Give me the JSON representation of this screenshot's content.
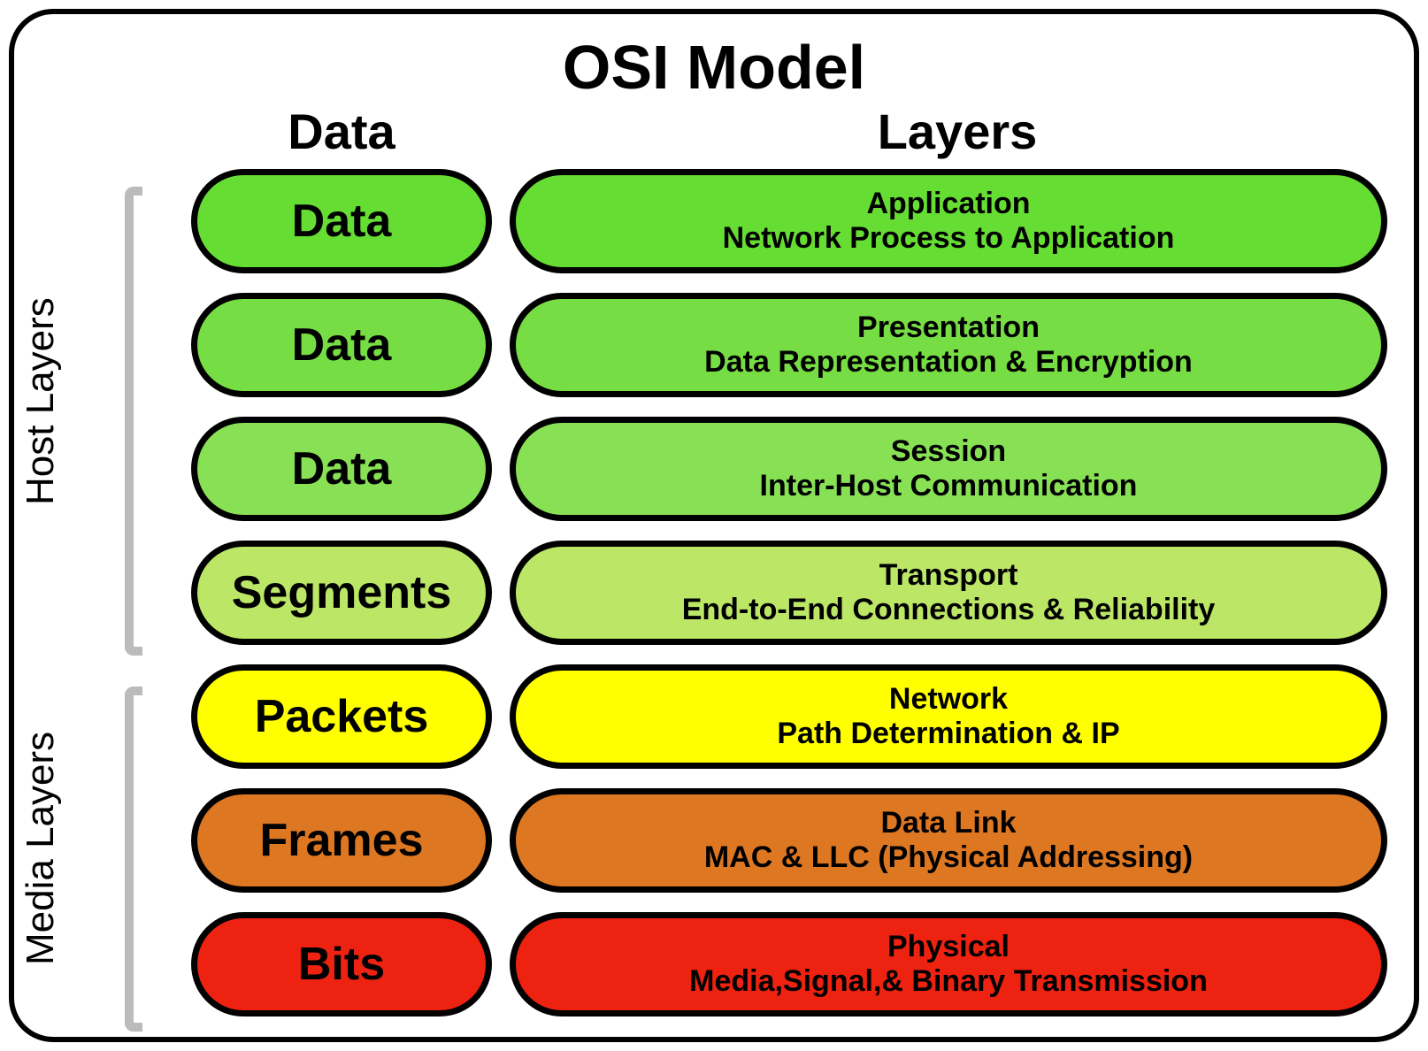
{
  "title": "OSI Model",
  "column_headers": {
    "data": "Data",
    "layers": "Layers"
  },
  "group_labels": {
    "host": "Host Layers",
    "media": "Media Layers"
  },
  "rows": [
    {
      "data_label": "Data",
      "layer_name": "Application",
      "layer_desc": "Network Process to Application",
      "color": "green1",
      "group": "host"
    },
    {
      "data_label": "Data",
      "layer_name": "Presentation",
      "layer_desc": "Data Representation & Encryption",
      "color": "green2",
      "group": "host"
    },
    {
      "data_label": "Data",
      "layer_name": "Session",
      "layer_desc": "Inter-Host Communication",
      "color": "green3",
      "group": "host"
    },
    {
      "data_label": "Segments",
      "layer_name": "Transport",
      "layer_desc": "End-to-End Connections & Reliability",
      "color": "yellowgreen",
      "group": "host"
    },
    {
      "data_label": "Packets",
      "layer_name": "Network",
      "layer_desc": "Path Determination & IP",
      "color": "yellow",
      "group": "media"
    },
    {
      "data_label": "Frames",
      "layer_name": "Data Link",
      "layer_desc": "MAC & LLC (Physical Addressing)",
      "color": "orange",
      "group": "media"
    },
    {
      "data_label": "Bits",
      "layer_name": "Physical",
      "layer_desc": "Media,Signal,& Binary Transmission",
      "color": "red",
      "group": "media"
    }
  ]
}
